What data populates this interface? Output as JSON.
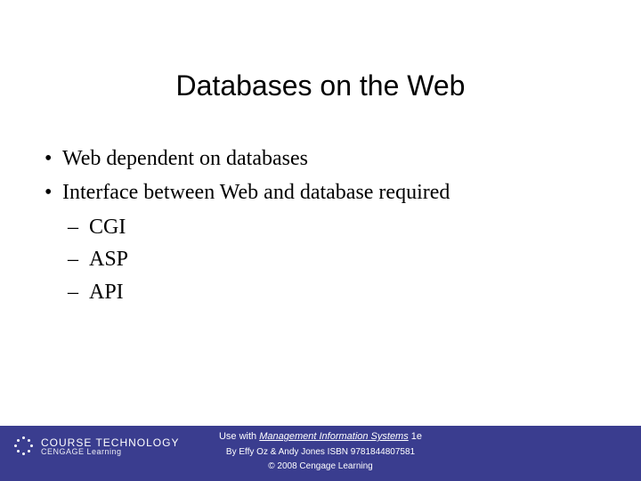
{
  "title": "Databases on the Web",
  "bullets": {
    "b1a": "Web dependent on databases",
    "b1b": "Interface between Web and database required",
    "b2a": "CGI",
    "b2b": "ASP",
    "b2c": "API"
  },
  "footer": {
    "brand_line1": "COURSE TECHNOLOGY",
    "brand_line2": "CENGAGE Learning",
    "use_with_prefix": "Use with ",
    "book_title": "Management Information Systems",
    "edition_suffix": " 1e",
    "byline": "By Effy Oz & Andy Jones ISBN 9781844807581",
    "copyright": "© 2008 Cengage Learning"
  }
}
